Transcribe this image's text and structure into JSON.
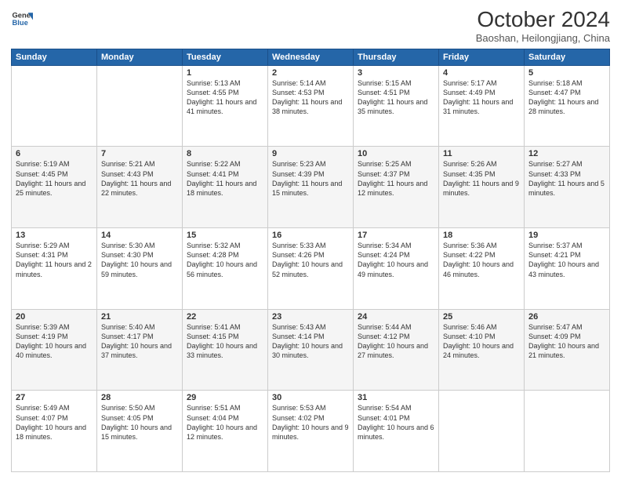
{
  "header": {
    "logo_line1": "General",
    "logo_line2": "Blue",
    "month": "October 2024",
    "location": "Baoshan, Heilongjiang, China"
  },
  "days_of_week": [
    "Sunday",
    "Monday",
    "Tuesday",
    "Wednesday",
    "Thursday",
    "Friday",
    "Saturday"
  ],
  "weeks": [
    [
      {
        "day": "",
        "info": ""
      },
      {
        "day": "",
        "info": ""
      },
      {
        "day": "1",
        "info": "Sunrise: 5:13 AM\nSunset: 4:55 PM\nDaylight: 11 hours and 41 minutes."
      },
      {
        "day": "2",
        "info": "Sunrise: 5:14 AM\nSunset: 4:53 PM\nDaylight: 11 hours and 38 minutes."
      },
      {
        "day": "3",
        "info": "Sunrise: 5:15 AM\nSunset: 4:51 PM\nDaylight: 11 hours and 35 minutes."
      },
      {
        "day": "4",
        "info": "Sunrise: 5:17 AM\nSunset: 4:49 PM\nDaylight: 11 hours and 31 minutes."
      },
      {
        "day": "5",
        "info": "Sunrise: 5:18 AM\nSunset: 4:47 PM\nDaylight: 11 hours and 28 minutes."
      }
    ],
    [
      {
        "day": "6",
        "info": "Sunrise: 5:19 AM\nSunset: 4:45 PM\nDaylight: 11 hours and 25 minutes."
      },
      {
        "day": "7",
        "info": "Sunrise: 5:21 AM\nSunset: 4:43 PM\nDaylight: 11 hours and 22 minutes."
      },
      {
        "day": "8",
        "info": "Sunrise: 5:22 AM\nSunset: 4:41 PM\nDaylight: 11 hours and 18 minutes."
      },
      {
        "day": "9",
        "info": "Sunrise: 5:23 AM\nSunset: 4:39 PM\nDaylight: 11 hours and 15 minutes."
      },
      {
        "day": "10",
        "info": "Sunrise: 5:25 AM\nSunset: 4:37 PM\nDaylight: 11 hours and 12 minutes."
      },
      {
        "day": "11",
        "info": "Sunrise: 5:26 AM\nSunset: 4:35 PM\nDaylight: 11 hours and 9 minutes."
      },
      {
        "day": "12",
        "info": "Sunrise: 5:27 AM\nSunset: 4:33 PM\nDaylight: 11 hours and 5 minutes."
      }
    ],
    [
      {
        "day": "13",
        "info": "Sunrise: 5:29 AM\nSunset: 4:31 PM\nDaylight: 11 hours and 2 minutes."
      },
      {
        "day": "14",
        "info": "Sunrise: 5:30 AM\nSunset: 4:30 PM\nDaylight: 10 hours and 59 minutes."
      },
      {
        "day": "15",
        "info": "Sunrise: 5:32 AM\nSunset: 4:28 PM\nDaylight: 10 hours and 56 minutes."
      },
      {
        "day": "16",
        "info": "Sunrise: 5:33 AM\nSunset: 4:26 PM\nDaylight: 10 hours and 52 minutes."
      },
      {
        "day": "17",
        "info": "Sunrise: 5:34 AM\nSunset: 4:24 PM\nDaylight: 10 hours and 49 minutes."
      },
      {
        "day": "18",
        "info": "Sunrise: 5:36 AM\nSunset: 4:22 PM\nDaylight: 10 hours and 46 minutes."
      },
      {
        "day": "19",
        "info": "Sunrise: 5:37 AM\nSunset: 4:21 PM\nDaylight: 10 hours and 43 minutes."
      }
    ],
    [
      {
        "day": "20",
        "info": "Sunrise: 5:39 AM\nSunset: 4:19 PM\nDaylight: 10 hours and 40 minutes."
      },
      {
        "day": "21",
        "info": "Sunrise: 5:40 AM\nSunset: 4:17 PM\nDaylight: 10 hours and 37 minutes."
      },
      {
        "day": "22",
        "info": "Sunrise: 5:41 AM\nSunset: 4:15 PM\nDaylight: 10 hours and 33 minutes."
      },
      {
        "day": "23",
        "info": "Sunrise: 5:43 AM\nSunset: 4:14 PM\nDaylight: 10 hours and 30 minutes."
      },
      {
        "day": "24",
        "info": "Sunrise: 5:44 AM\nSunset: 4:12 PM\nDaylight: 10 hours and 27 minutes."
      },
      {
        "day": "25",
        "info": "Sunrise: 5:46 AM\nSunset: 4:10 PM\nDaylight: 10 hours and 24 minutes."
      },
      {
        "day": "26",
        "info": "Sunrise: 5:47 AM\nSunset: 4:09 PM\nDaylight: 10 hours and 21 minutes."
      }
    ],
    [
      {
        "day": "27",
        "info": "Sunrise: 5:49 AM\nSunset: 4:07 PM\nDaylight: 10 hours and 18 minutes."
      },
      {
        "day": "28",
        "info": "Sunrise: 5:50 AM\nSunset: 4:05 PM\nDaylight: 10 hours and 15 minutes."
      },
      {
        "day": "29",
        "info": "Sunrise: 5:51 AM\nSunset: 4:04 PM\nDaylight: 10 hours and 12 minutes."
      },
      {
        "day": "30",
        "info": "Sunrise: 5:53 AM\nSunset: 4:02 PM\nDaylight: 10 hours and 9 minutes."
      },
      {
        "day": "31",
        "info": "Sunrise: 5:54 AM\nSunset: 4:01 PM\nDaylight: 10 hours and 6 minutes."
      },
      {
        "day": "",
        "info": ""
      },
      {
        "day": "",
        "info": ""
      }
    ]
  ]
}
